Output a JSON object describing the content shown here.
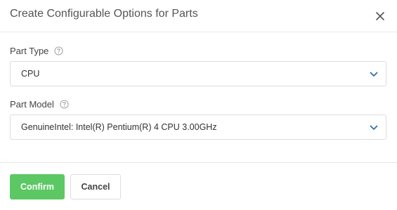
{
  "dialog": {
    "title": "Create Configurable Options for Parts",
    "close_icon": "close-icon"
  },
  "fields": {
    "part_type": {
      "label": "Part Type",
      "help_icon": "question-circle-icon",
      "value": "CPU"
    },
    "part_model": {
      "label": "Part Model",
      "help_icon": "question-circle-icon",
      "value": "GenuineIntel: Intel(R) Pentium(R) 4 CPU 3.00GHz"
    }
  },
  "footer": {
    "confirm_label": "Confirm",
    "cancel_label": "Cancel"
  },
  "colors": {
    "confirm": "#5cc864",
    "chevron": "#2f6fb5"
  }
}
